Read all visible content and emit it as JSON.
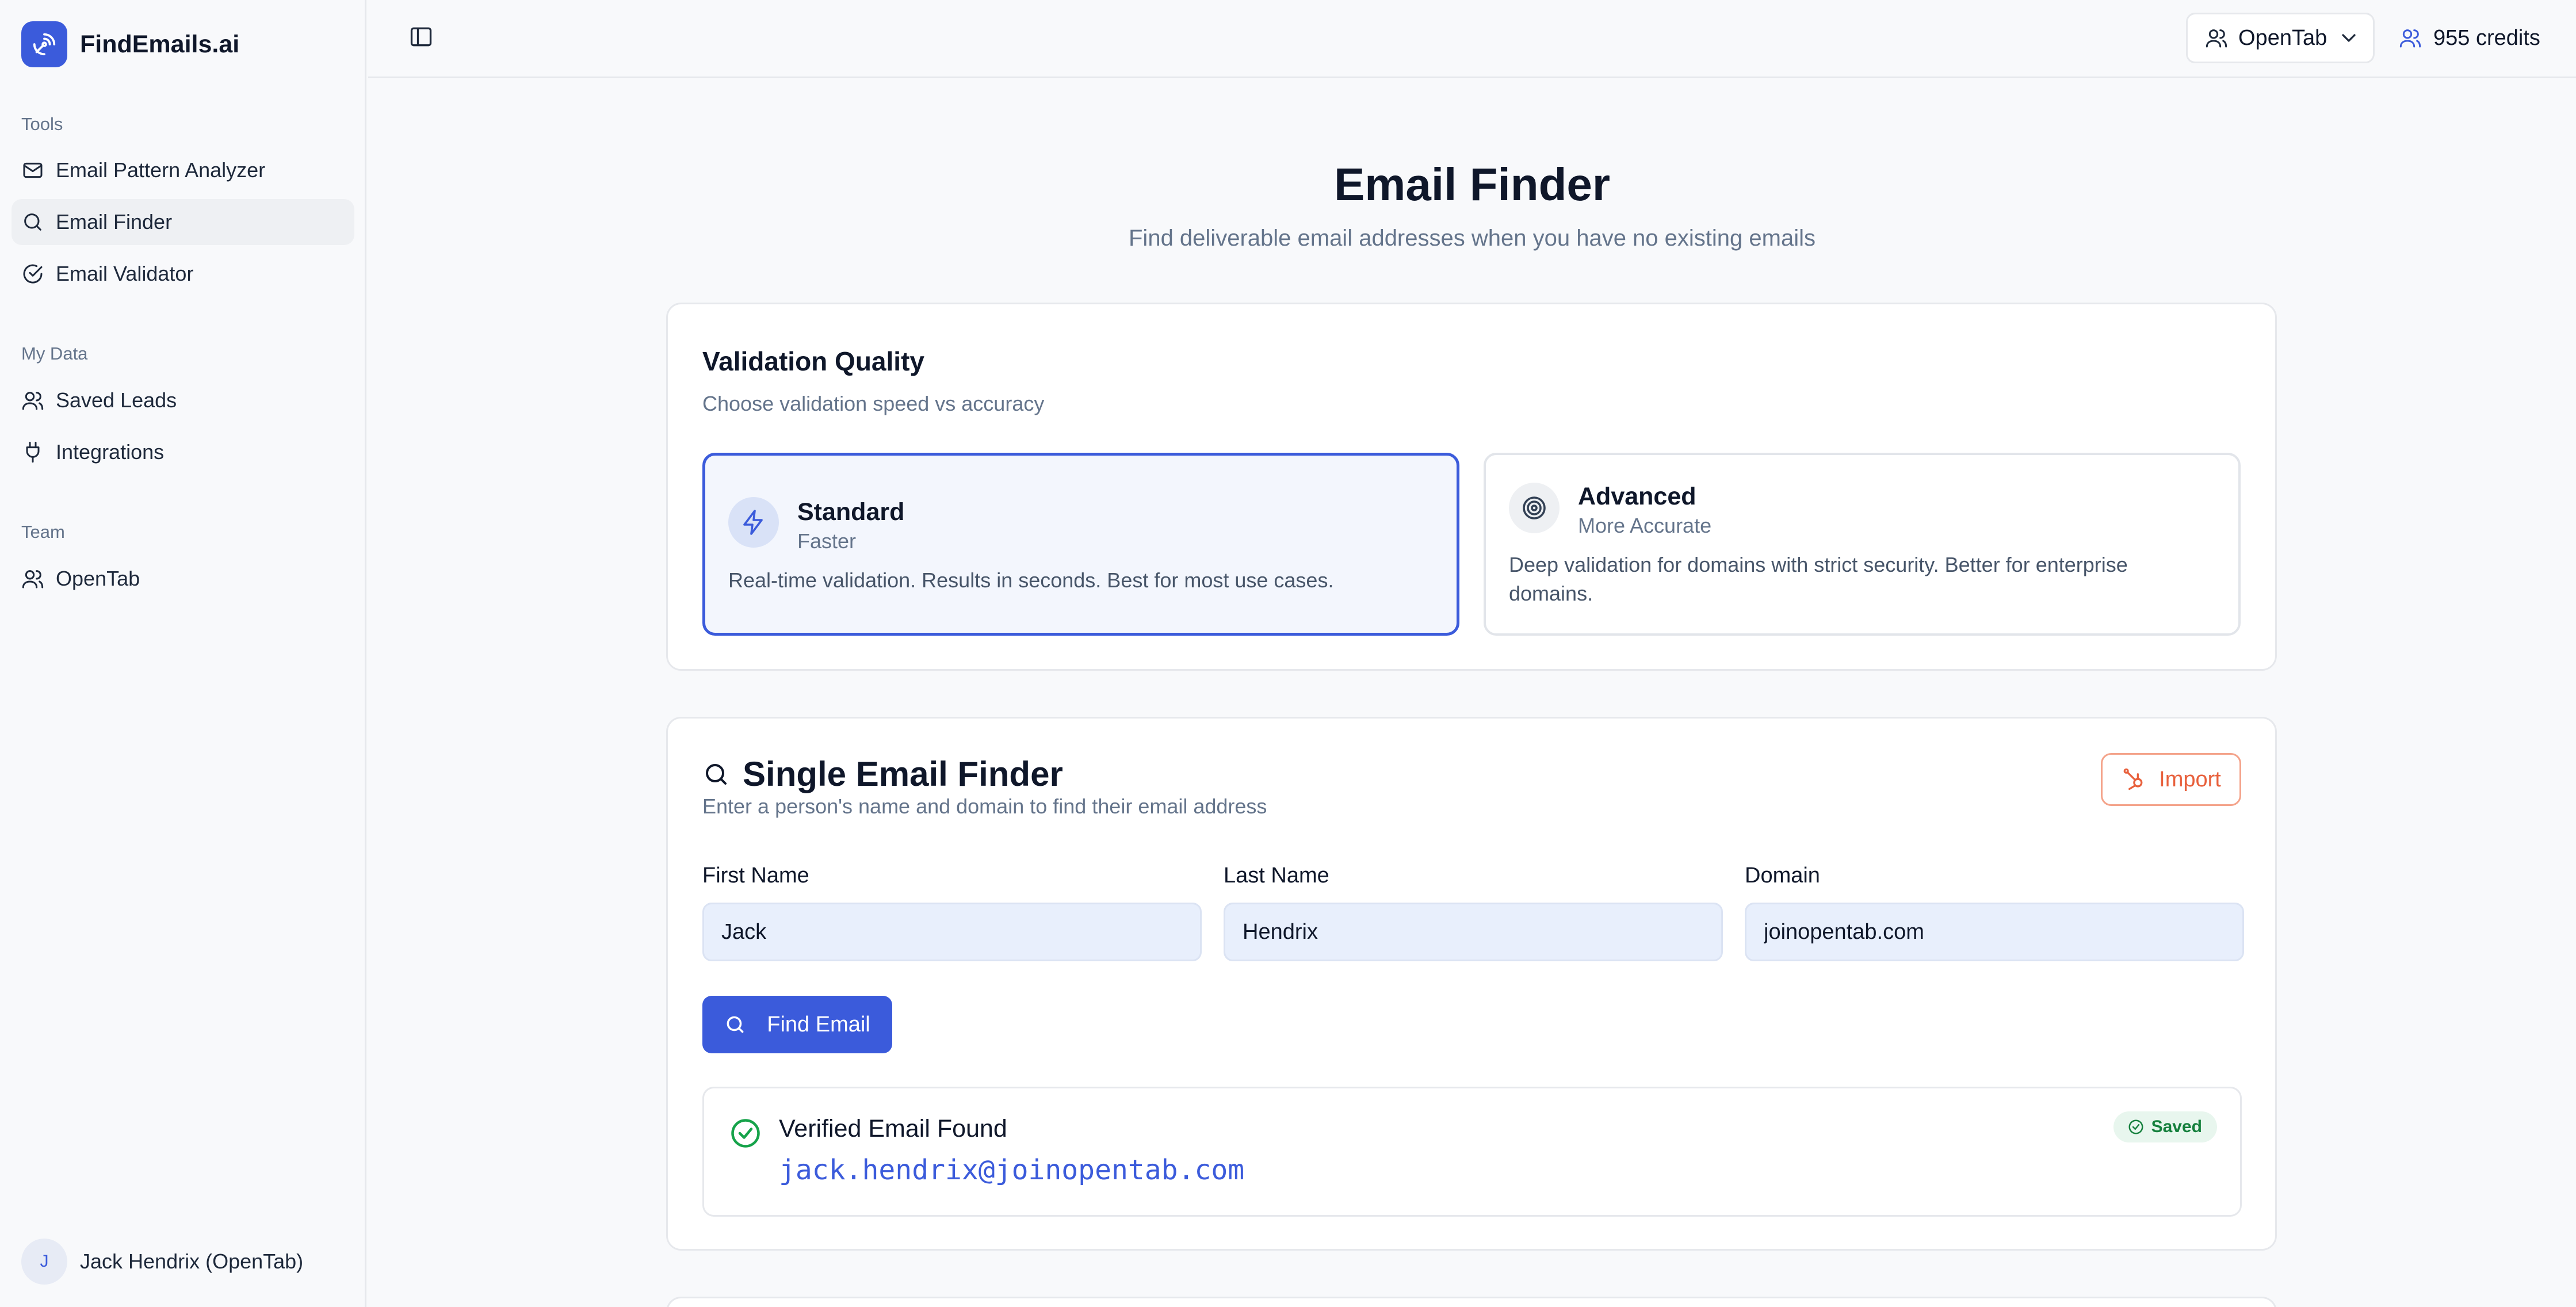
{
  "brand": {
    "name": "FindEmails.ai"
  },
  "sidebar": {
    "sections": [
      {
        "title": "Tools",
        "items": [
          {
            "label": "Email Pattern Analyzer",
            "icon": "mail-icon"
          },
          {
            "label": "Email Finder",
            "icon": "search-icon",
            "active": true
          },
          {
            "label": "Email Validator",
            "icon": "check-circle-icon"
          }
        ]
      },
      {
        "title": "My Data",
        "items": [
          {
            "label": "Saved Leads",
            "icon": "users-icon"
          },
          {
            "label": "Integrations",
            "icon": "plug-icon"
          }
        ]
      },
      {
        "title": "Team",
        "items": [
          {
            "label": "OpenTab",
            "icon": "users-icon"
          }
        ]
      }
    ],
    "user": {
      "initial": "J",
      "name": "Jack Hendrix (OpenTab)"
    }
  },
  "topbar": {
    "team": "OpenTab",
    "credits": "955 credits"
  },
  "page": {
    "title": "Email Finder",
    "subtitle": "Find deliverable email addresses when you have no existing emails"
  },
  "validation": {
    "title": "Validation Quality",
    "subtitle": "Choose validation speed vs accuracy",
    "options": [
      {
        "title": "Standard",
        "tag": "Faster",
        "description": "Real-time validation. Results in seconds. Best for most use cases.",
        "selected": true
      },
      {
        "title": "Advanced",
        "tag": "More Accurate",
        "description": "Deep validation for domains with strict security. Better for enterprise domains.",
        "selected": false
      }
    ]
  },
  "finder": {
    "title": "Single Email Finder",
    "subtitle": "Enter a person's name and domain to find their email address",
    "import_label": "Import",
    "fields": [
      {
        "label": "First Name",
        "value": "Jack"
      },
      {
        "label": "Last Name",
        "value": "Hendrix"
      },
      {
        "label": "Domain",
        "value": "joinopentab.com"
      }
    ],
    "find_label": "Find Email",
    "result": {
      "title": "Verified Email Found",
      "email": "jack.hendrix@joinopentab.com",
      "badge": "Saved"
    }
  },
  "colors": {
    "accent": "#3b5bdb",
    "success": "#15803d",
    "import": "#e8603c"
  }
}
